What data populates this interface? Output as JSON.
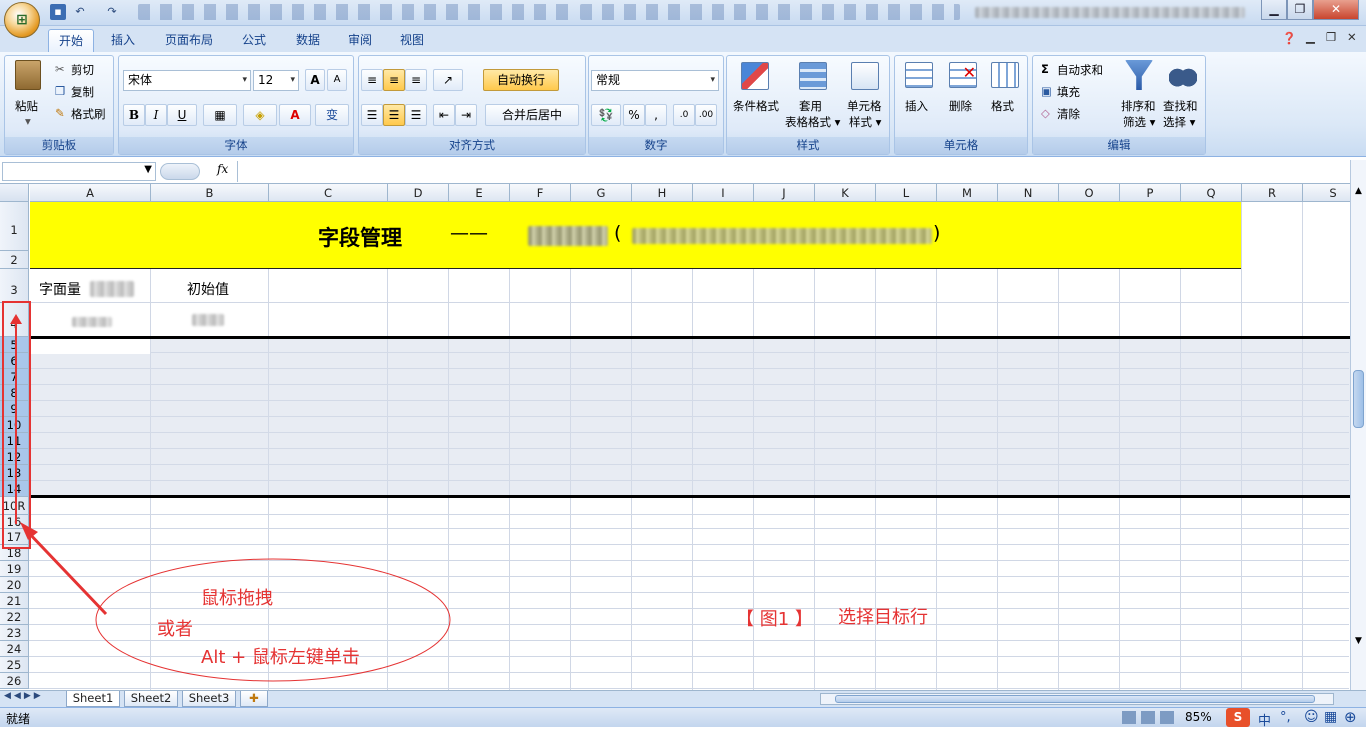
{
  "ribbon_tabs": [
    "开始",
    "插入",
    "页面布局",
    "公式",
    "数据",
    "审阅",
    "视图"
  ],
  "clipboard": {
    "paste": "粘贴",
    "cut": "剪切",
    "copy": "复制",
    "format_painter": "格式刷",
    "label": "剪贴板"
  },
  "font": {
    "name": "宋体",
    "size": "12",
    "label": "字体",
    "bold": "B",
    "italic": "I",
    "underline": "U",
    "grow": "A",
    "shrink": "A"
  },
  "alignment": {
    "wrap": "自动换行",
    "merge": "合并后居中",
    "label": "对齐方式"
  },
  "number": {
    "format": "常规",
    "percent": "%",
    "comma": ",",
    "label": "数字"
  },
  "styles": {
    "conditional": "条件格式",
    "table": "套用\n表格格式",
    "cell": "单元格\n样式",
    "label": "样式"
  },
  "cells": {
    "insert": "插入",
    "delete": "删除",
    "format": "格式",
    "label": "单元格"
  },
  "editing": {
    "autosum": "自动求和",
    "fill": "填充",
    "clear": "清除",
    "sort": "排序和\n筛选",
    "find": "查找和\n选择",
    "label": "编辑"
  },
  "formula_bar": {
    "fx": "fx",
    "name_box": "",
    "formula": ""
  },
  "columns": [
    "A",
    "B",
    "C",
    "D",
    "E",
    "F",
    "G",
    "H",
    "I",
    "J",
    "K",
    "L",
    "M",
    "N",
    "O",
    "P",
    "Q",
    "R",
    "S"
  ],
  "rows": [
    "1",
    "2",
    "3",
    "4",
    "5",
    "6",
    "7",
    "8",
    "9",
    "10",
    "11",
    "12",
    "13",
    "14",
    "10R",
    "16",
    "17",
    "18",
    "19",
    "20",
    "21",
    "22",
    "23",
    "24",
    "25",
    "26"
  ],
  "sheet": {
    "title": "字段管理",
    "title_dash": "——",
    "title_paren_open": "(",
    "title_paren_close": ")",
    "header_a": "字面量",
    "header_b": "初始值"
  },
  "annotation": {
    "line1": "鼠标拖拽",
    "line2": "或者",
    "line3": "Alt + 鼠标左键单击",
    "figure": "【 图1 】",
    "caption": "选择目标行"
  },
  "sheet_tabs": [
    "Sheet1",
    "Sheet2",
    "Sheet3"
  ],
  "status": {
    "ready": "就绪",
    "zoom": "85%",
    "ime": "中",
    "ime_punct": "°,"
  }
}
